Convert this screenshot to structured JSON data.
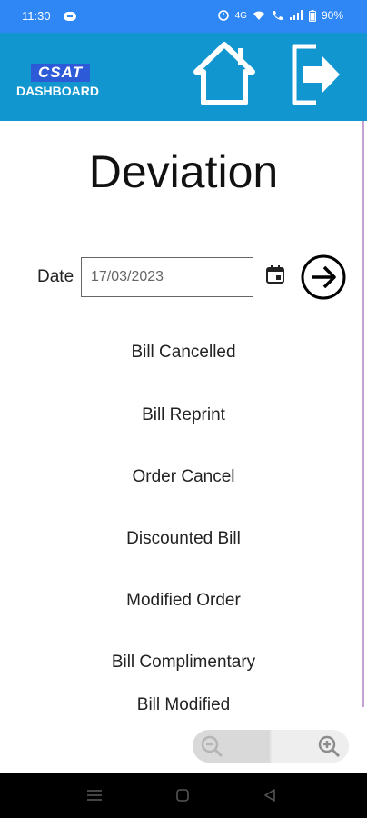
{
  "status": {
    "time": "11:30",
    "battery": "90%",
    "network": "4G"
  },
  "header": {
    "logo_top": "CSAT",
    "logo_bottom": "DASHBOARD"
  },
  "page": {
    "title": "Deviation",
    "date_label": "Date",
    "date_value": "17/03/2023"
  },
  "menu": [
    "Bill Cancelled",
    "Bill Reprint",
    "Order Cancel",
    "Discounted Bill",
    "Modified Order",
    "Bill Complimentary",
    "Bill Modified"
  ],
  "colors": {
    "status_bar": "#2f86f5",
    "header": "#1196cf",
    "accent_scroll": "#c8a3d2"
  },
  "icons": {
    "home": "home-icon",
    "exit": "exit-icon",
    "calendar": "calendar-icon",
    "go": "arrow-right-circle-icon",
    "zoom_out": "zoom-out-icon",
    "zoom_in": "zoom-in-icon"
  }
}
